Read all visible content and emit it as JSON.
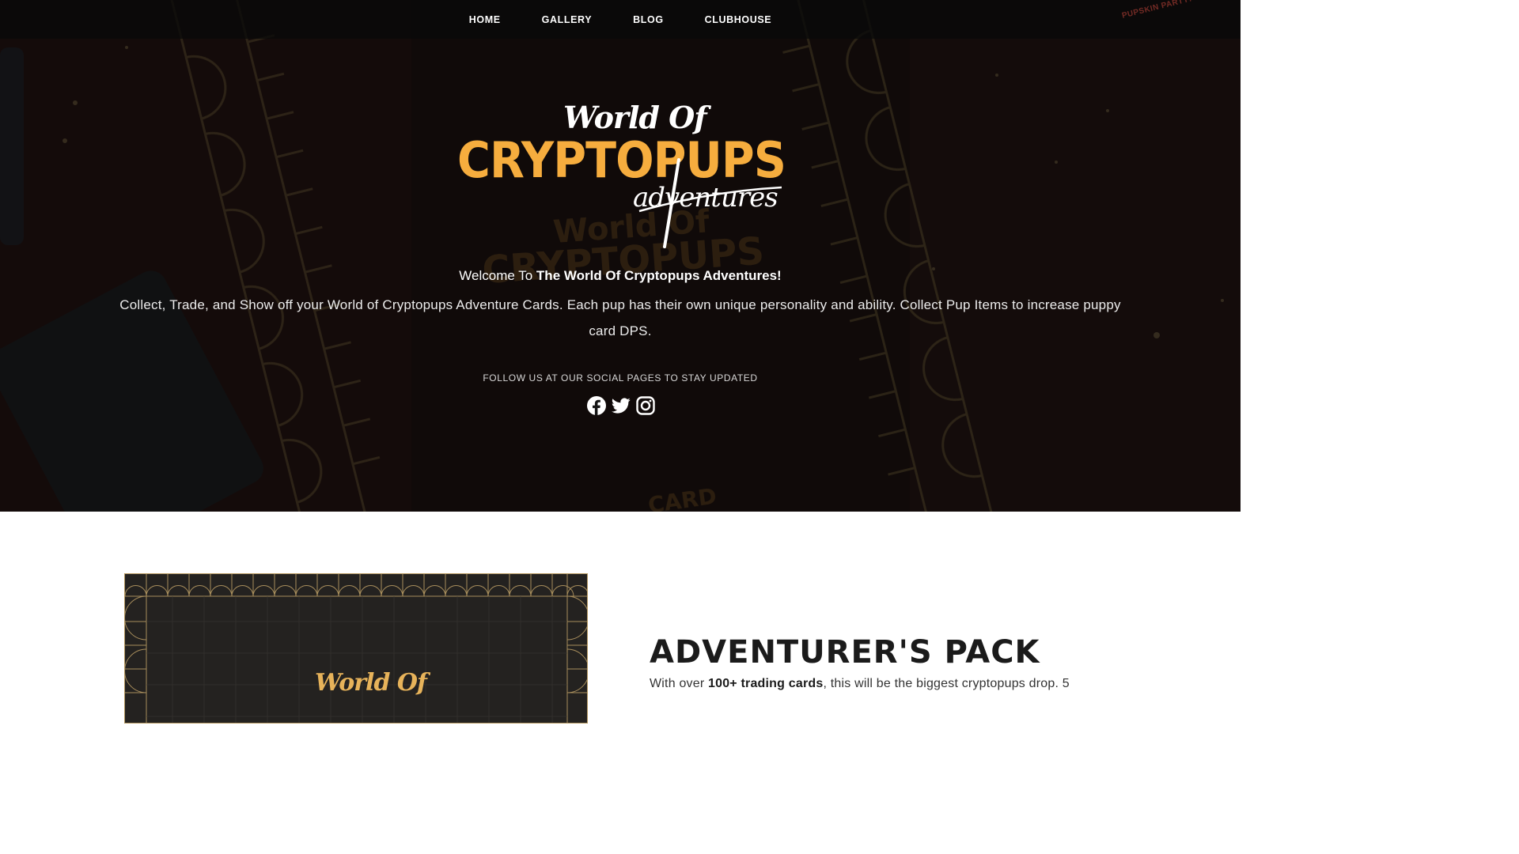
{
  "nav": {
    "items": [
      "HOME",
      "GALLERY",
      "BLOG",
      "CLUBHOUSE"
    ]
  },
  "hero": {
    "background_badge": "PUPSKIN PARTY!",
    "logo": {
      "line1": "World Of",
      "line2": "CRYPTOPUPS",
      "line3": "adventures"
    },
    "welcome_prefix": "Welcome To ",
    "welcome_bold": "The World Of Cryptopups Adventures!",
    "description": "Collect, Trade, and Show off your World of Cryptopups Adventure Cards. Each pup has their own unique personality and ability. Collect Pup Items to increase puppy card DPS.",
    "follow_text": "FOLLOW US AT OUR SOCIAL PAGES TO STAY UPDATED",
    "social_icons": [
      "facebook-icon",
      "twitter-icon",
      "instagram-icon"
    ]
  },
  "pack": {
    "card_logo": "World Of",
    "title": "ADVENTURER'S PACK",
    "text_prefix": "With over ",
    "text_bold": "100+ trading cards",
    "text_suffix": ", this will be the biggest cryptopups drop. 5"
  },
  "colors": {
    "accent_orange": "#f6ad3e",
    "hero_background": "#0d0b0a",
    "card_border": "#b79a63"
  }
}
